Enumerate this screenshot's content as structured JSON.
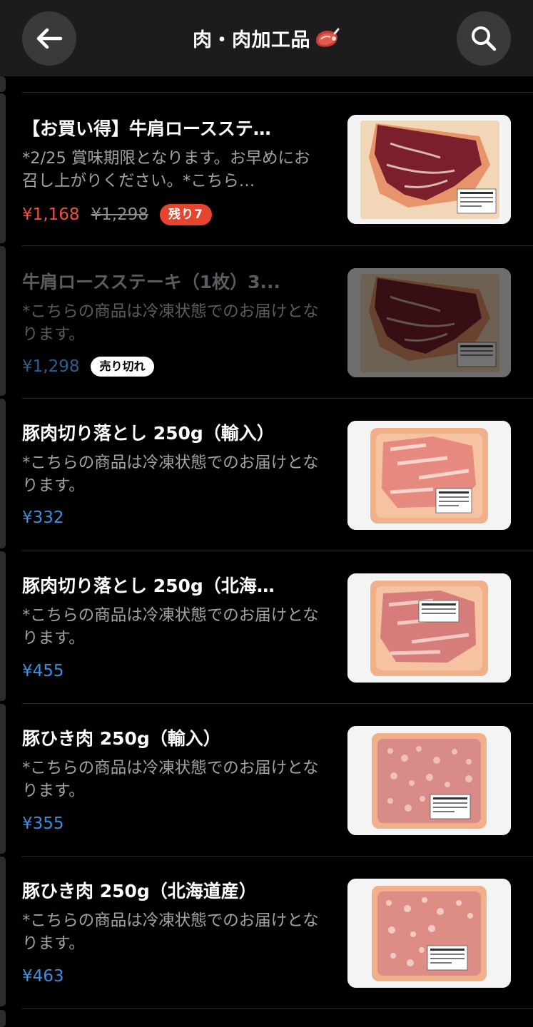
{
  "header": {
    "title": "肉・肉加工品",
    "title_icon": "steak-icon",
    "back_icon": "arrow-left-icon",
    "search_icon": "search-icon"
  },
  "colors": {
    "background": "#000000",
    "header_bg": "#1c1c1e",
    "price_blue": "#3a8fde",
    "sale_red": "#f24e3a",
    "badge_red": "#e7442f"
  },
  "products": [
    {
      "name": "【お買い得】牛肩ロースステ…",
      "desc": "*2/25 賞味期限となります。お早めにお召し上がりください。*こちら…",
      "price": "¥1,168",
      "old_price": "¥1,298",
      "badge": "残り7",
      "image": "beef-steak-pack"
    },
    {
      "name": "牛肩ロースステーキ（1枚）3...",
      "desc": "*こちらの商品は冷凍状態でのお届けとなります。",
      "price": "¥1,298",
      "badge": "売り切れ",
      "image": "beef-steak-pack"
    },
    {
      "name": "豚肉切り落とし 250g（輸入）",
      "desc": "*こちらの商品は冷凍状態でのお届けとなります。",
      "price": "¥332",
      "image": "pork-slices-pack"
    },
    {
      "name": "豚肉切り落とし 250g（北海…",
      "desc": "*こちらの商品は冷凍状態でのお届けとなります。",
      "price": "¥455",
      "image": "pork-slices-pack"
    },
    {
      "name": "豚ひき肉 250g（輸入）",
      "desc": "*こちらの商品は冷凍状態でのお届けとなります。",
      "price": "¥355",
      "image": "ground-pork-pack"
    },
    {
      "name": "豚ひき肉 250g（北海道産）",
      "desc": "*こちらの商品は冷凍状態でのお届けとなります。",
      "price": "¥463",
      "image": "ground-pork-pack"
    }
  ]
}
